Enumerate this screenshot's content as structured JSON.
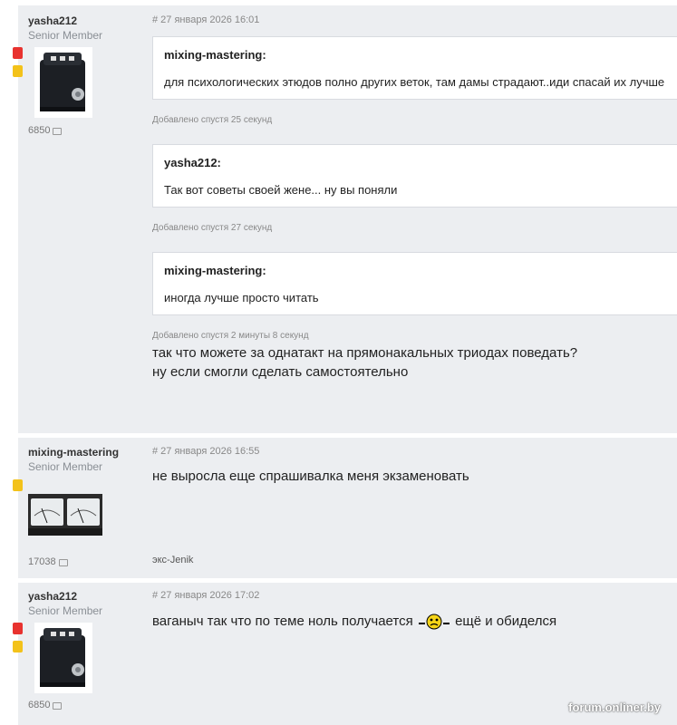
{
  "posts": [
    {
      "author": "yasha212",
      "rank": "Senior Member",
      "count": "6850",
      "date": "# 27 января 2026 16:01",
      "quotes": [
        {
          "author": "mixing-mastering:",
          "text": "для психологических этюдов полно других веток, там дамы страдают..иди спасай их лучше"
        },
        {
          "author": "yasha212:",
          "text": "Так вот советы своей жене... ну вы поняли"
        },
        {
          "author": "mixing-mastering:",
          "text": "иногда лучше просто читать"
        }
      ],
      "added": [
        "Добавлено спустя 25 секунд",
        "Добавлено спустя 27 секунд",
        "Добавлено спустя 2 минуты 8 секунд"
      ],
      "body_lines": [
        "так что можете за однатакт на прямонакальных триодах поведать?",
        "ну если смогли сделать самостоятельно"
      ]
    },
    {
      "author": "mixing-mastering",
      "rank": "Senior Member",
      "count": "17038",
      "date": "# 27 января 2026 16:55",
      "body_lines": [
        "не выросла еще спрашивалка меня экзаменовать"
      ],
      "signature": "экс-Jenik"
    },
    {
      "author": "yasha212",
      "rank": "Senior Member",
      "count": "6850",
      "date": "# 27 января 2026 17:02",
      "body_before": "ваганыч так что по теме ноль получается",
      "body_after": "ещё и обиделся"
    }
  ],
  "watermark": "forum.onliner.by",
  "colors": {
    "post_bg": "#eceef1",
    "flag_red": "#e8322f",
    "flag_yellow": "#f3c21a"
  }
}
